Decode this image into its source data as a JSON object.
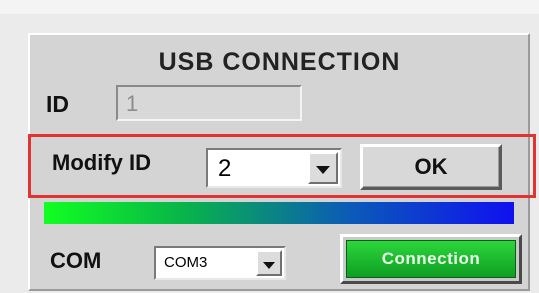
{
  "panel": {
    "title": "USB CONNECTION",
    "id_label": "ID",
    "id_value": "1",
    "modify_label": "Modify ID",
    "modify_value": "2",
    "ok_label": "OK",
    "com_label": "COM",
    "com_value": "COM3",
    "connection_label": "Connection"
  },
  "colors": {
    "highlight_border": "#e23333",
    "connection_button": "#1bb82e",
    "gradient_start": "#11ff22",
    "gradient_end": "#1010f0"
  },
  "icons": {
    "dropdown": "chevron-down-icon"
  }
}
